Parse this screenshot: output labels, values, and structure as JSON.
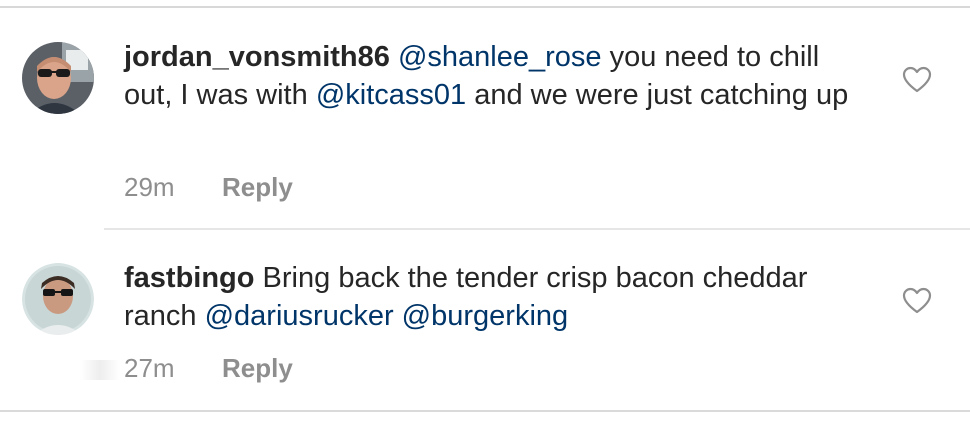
{
  "comments": [
    {
      "username": "jordan_vonsmith86",
      "segments": [
        {
          "type": "mention",
          "text": "@shanlee_rose"
        },
        {
          "type": "text",
          "text": " you need to chill out, I was with "
        },
        {
          "type": "mention",
          "text": "@kitcass01"
        },
        {
          "type": "text",
          "text": " and we were just catching up"
        }
      ],
      "time": "29m",
      "reply_label": "Reply",
      "avatar_icon": "user-avatar-sunglasses",
      "like_icon": "heart-outline-icon"
    },
    {
      "username": "fastbingo",
      "segments": [
        {
          "type": "text",
          "text": " Bring back the tender crisp bacon cheddar ranch "
        },
        {
          "type": "mention",
          "text": "@dariusrucker"
        },
        {
          "type": "text",
          "text": " "
        },
        {
          "type": "mention",
          "text": "@burgerking"
        }
      ],
      "time": "27m",
      "reply_label": "Reply",
      "avatar_icon": "user-avatar-sunglasses",
      "like_icon": "heart-outline-icon"
    }
  ],
  "colors": {
    "text": "#262626",
    "mention": "#003569",
    "meta": "#8e8e8e",
    "divider": "#e6e6e6"
  }
}
